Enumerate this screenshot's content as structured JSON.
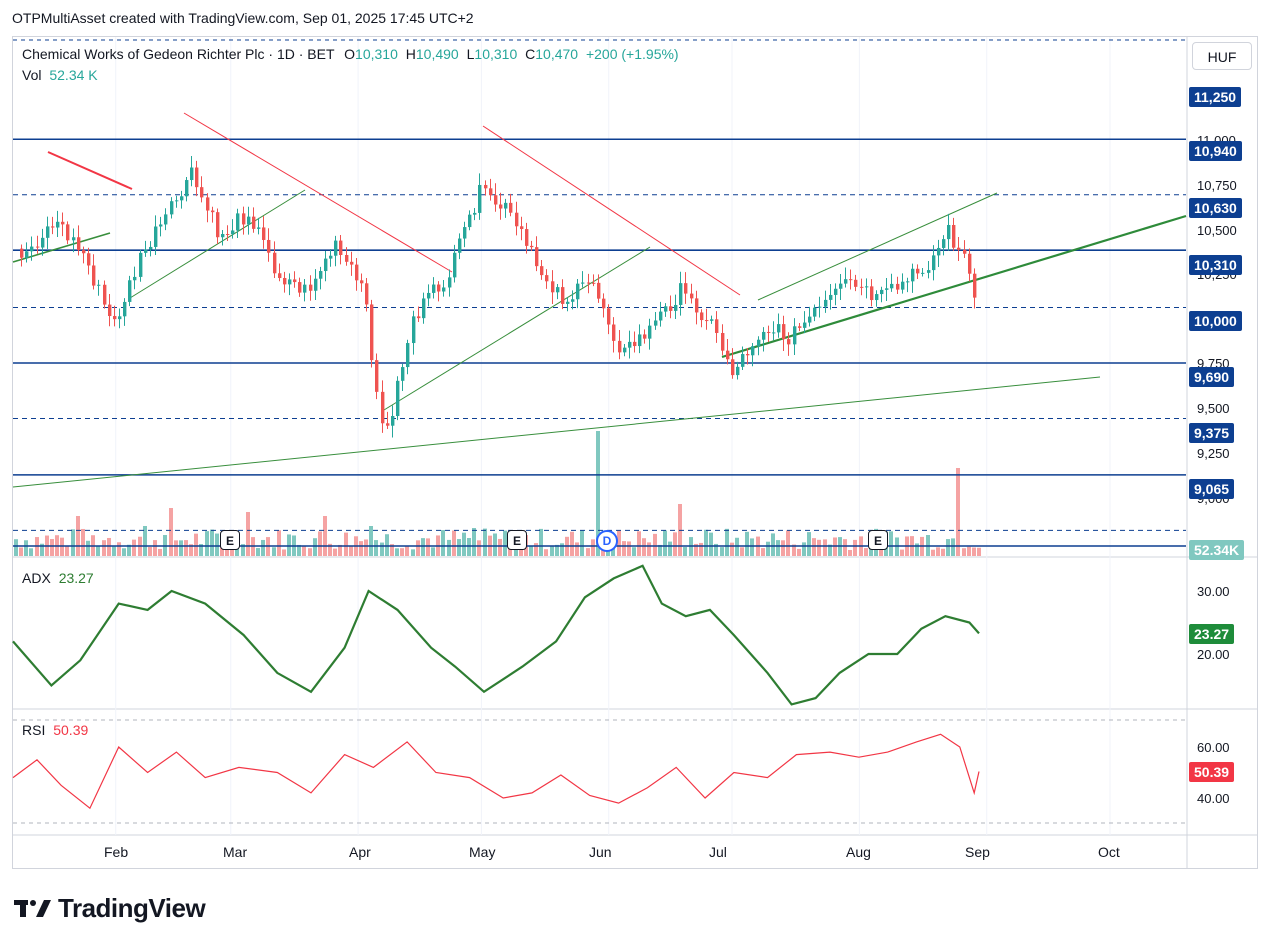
{
  "header": {
    "text": "OTPMultiAsset created with TradingView.com, Sep 01, 2025 17:45 UTC+2"
  },
  "legend": {
    "title": "Chemical Works of Gedeon Richter Plc · 1D · BET",
    "o_label": "O",
    "o_value": "10,310",
    "h_label": "H",
    "h_value": "10,490",
    "l_label": "L",
    "l_value": "10,310",
    "c_label": "C",
    "c_value": "10,470",
    "change": "+200 (+1.95%)",
    "vol_label": "Vol",
    "vol_value": "52.34 K"
  },
  "currency_button": "HUF",
  "events": {
    "earnings": "E",
    "dividend": "D"
  },
  "adx_legend": {
    "label": "ADX",
    "value": "23.27"
  },
  "rsi_legend": {
    "label": "RSI",
    "value": "50.39"
  },
  "price_axis_ticks": [
    "11,000",
    "10,750",
    "10,500",
    "10,250",
    "9,750",
    "9,500",
    "9,250",
    "9,000"
  ],
  "price_badges": [
    {
      "label": "11,250",
      "color": "#0d3f91"
    },
    {
      "label": "10,940",
      "color": "#0d3f91"
    },
    {
      "label": "10,630",
      "color": "#0d3f91"
    },
    {
      "label": "10,310",
      "color": "#0d3f91"
    },
    {
      "label": "10,000",
      "color": "#0d3f91"
    },
    {
      "label": "9,690",
      "color": "#0d3f91"
    },
    {
      "label": "9,375",
      "color": "#0d3f91"
    },
    {
      "label": "9,065",
      "color": "#0d3f91"
    },
    {
      "label": "52.34K",
      "color": "#80c8c0"
    }
  ],
  "adx_axis": {
    "ticks": [
      "30.00",
      "20.00"
    ],
    "badge": "23.27",
    "badge_color": "#1e8c3a"
  },
  "rsi_axis": {
    "ticks": [
      "60.00",
      "40.00"
    ],
    "badge": "50.39",
    "badge_color": "#f23645"
  },
  "x_labels": [
    "Feb",
    "Mar",
    "Apr",
    "May",
    "Jun",
    "Jul",
    "Aug",
    "Sep",
    "Oct"
  ],
  "brand": "TradingView",
  "colors": {
    "up": "#26a69a",
    "down": "#ef5350",
    "level": "#0d3f91",
    "trend": "#388e3c",
    "adx": "#2e7d32",
    "rsi": "#f23645"
  },
  "chart_data": {
    "type": "candlestick",
    "title": "Chemical Works of Gedeon Richter Plc · 1D · BET",
    "currency": "HUF",
    "ylim": [
      8950,
      11350
    ],
    "horizontal_levels": [
      11250,
      10940,
      10630,
      10310,
      10000,
      9690,
      9375,
      9065
    ],
    "last_close": 10470,
    "volume_last": "52.34K",
    "close_path_approx": [
      {
        "x": "2025-01-10",
        "y": 10620
      },
      {
        "x": "2025-01-17",
        "y": 10800
      },
      {
        "x": "2025-01-24",
        "y": 10600
      },
      {
        "x": "2025-01-31",
        "y": 10200
      },
      {
        "x": "2025-02-07",
        "y": 10600
      },
      {
        "x": "2025-02-14",
        "y": 10850
      },
      {
        "x": "2025-02-19",
        "y": 11050
      },
      {
        "x": "2025-02-26",
        "y": 10700
      },
      {
        "x": "2025-03-05",
        "y": 10850
      },
      {
        "x": "2025-03-12",
        "y": 10500
      },
      {
        "x": "2025-03-19",
        "y": 10400
      },
      {
        "x": "2025-03-26",
        "y": 10650
      },
      {
        "x": "2025-04-02",
        "y": 10400
      },
      {
        "x": "2025-04-07",
        "y": 9550
      },
      {
        "x": "2025-04-14",
        "y": 10250
      },
      {
        "x": "2025-04-23",
        "y": 10500
      },
      {
        "x": "2025-04-30",
        "y": 10950
      },
      {
        "x": "2025-05-07",
        "y": 10850
      },
      {
        "x": "2025-05-14",
        "y": 10550
      },
      {
        "x": "2025-05-21",
        "y": 10350
      },
      {
        "x": "2025-05-28",
        "y": 10450
      },
      {
        "x": "2025-06-04",
        "y": 10050
      },
      {
        "x": "2025-06-11",
        "y": 10200
      },
      {
        "x": "2025-06-18",
        "y": 10400
      },
      {
        "x": "2025-06-25",
        "y": 10250
      },
      {
        "x": "2025-07-01",
        "y": 9950
      },
      {
        "x": "2025-07-08",
        "y": 10200
      },
      {
        "x": "2025-07-15",
        "y": 10150
      },
      {
        "x": "2025-07-22",
        "y": 10300
      },
      {
        "x": "2025-07-29",
        "y": 10450
      },
      {
        "x": "2025-08-05",
        "y": 10350
      },
      {
        "x": "2025-08-12",
        "y": 10450
      },
      {
        "x": "2025-08-19",
        "y": 10600
      },
      {
        "x": "2025-08-22",
        "y": 10750
      },
      {
        "x": "2025-08-27",
        "y": 10550
      },
      {
        "x": "2025-08-29",
        "y": 10270
      },
      {
        "x": "2025-09-01",
        "y": 10470
      }
    ],
    "adx": {
      "name": "ADX",
      "last": 23.27,
      "ylim": [
        10,
        35
      ],
      "values": [
        [
          0,
          22
        ],
        [
          8,
          15
        ],
        [
          14,
          19
        ],
        [
          22,
          28
        ],
        [
          28,
          27
        ],
        [
          33,
          30
        ],
        [
          40,
          28
        ],
        [
          48,
          23
        ],
        [
          55,
          17
        ],
        [
          62,
          14
        ],
        [
          69,
          21
        ],
        [
          74,
          30
        ],
        [
          80,
          27
        ],
        [
          87,
          21
        ],
        [
          92,
          18
        ],
        [
          98,
          14
        ],
        [
          106,
          18
        ],
        [
          113,
          22
        ],
        [
          119,
          29
        ],
        [
          125,
          32
        ],
        [
          131,
          34
        ],
        [
          135,
          28
        ],
        [
          140,
          26
        ],
        [
          145,
          27
        ],
        [
          150,
          23
        ],
        [
          157,
          17
        ],
        [
          162,
          12
        ],
        [
          167,
          13
        ],
        [
          172,
          17
        ],
        [
          178,
          20
        ],
        [
          184,
          20
        ],
        [
          189,
          24
        ],
        [
          194,
          26
        ],
        [
          199,
          25
        ],
        [
          201,
          23.27
        ]
      ]
    },
    "rsi": {
      "name": "RSI",
      "last": 50.39,
      "ylim": [
        30,
        75
      ],
      "values": [
        [
          0,
          48
        ],
        [
          5,
          55
        ],
        [
          10,
          45
        ],
        [
          16,
          36
        ],
        [
          22,
          60
        ],
        [
          28,
          50
        ],
        [
          34,
          58
        ],
        [
          40,
          48
        ],
        [
          47,
          52
        ],
        [
          55,
          50
        ],
        [
          62,
          42
        ],
        [
          69,
          57
        ],
        [
          75,
          52
        ],
        [
          82,
          62
        ],
        [
          88,
          50
        ],
        [
          95,
          48
        ],
        [
          102,
          40
        ],
        [
          108,
          42
        ],
        [
          114,
          49
        ],
        [
          120,
          41
        ],
        [
          126,
          38
        ],
        [
          132,
          44
        ],
        [
          138,
          52
        ],
        [
          144,
          40
        ],
        [
          150,
          50
        ],
        [
          157,
          48
        ],
        [
          163,
          57
        ],
        [
          170,
          58
        ],
        [
          176,
          56
        ],
        [
          182,
          58
        ],
        [
          188,
          62
        ],
        [
          193,
          65
        ],
        [
          197,
          60
        ],
        [
          200,
          42
        ],
        [
          201,
          50.39
        ]
      ]
    }
  }
}
